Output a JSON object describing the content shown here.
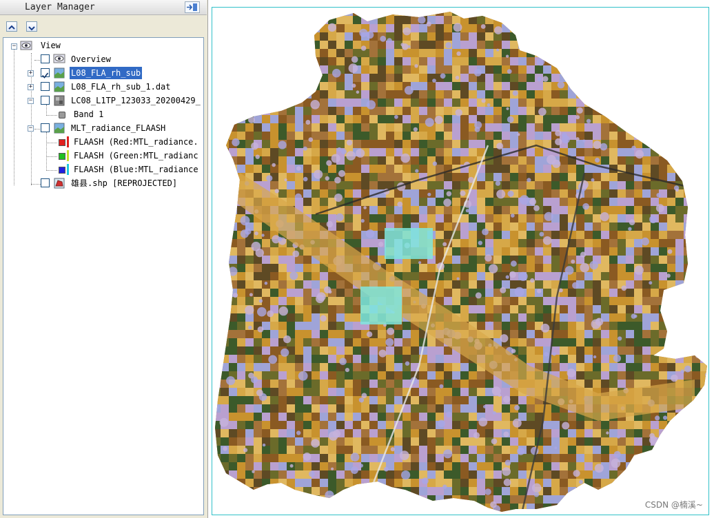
{
  "panel": {
    "title": "Layer Manager",
    "move_up_icon": "arrow-up-icon",
    "move_down_icon": "arrow-down-icon",
    "dock_icon": "dock-icon"
  },
  "tree": {
    "root": {
      "label": "View",
      "expanded": true
    },
    "overview": {
      "label": "Overview",
      "checked": false
    },
    "layers": [
      {
        "label": "L08_FLA_rh_sub",
        "checked": true,
        "selected": true,
        "expanded": false
      },
      {
        "label": "L08_FLA_rh_sub_1.dat",
        "checked": false,
        "expanded": false
      },
      {
        "label": "LC08_L1TP_123033_20200429_",
        "checked": false,
        "expanded": true,
        "children": [
          {
            "label": "Band 1",
            "swatch": "#9a9a9a"
          }
        ]
      },
      {
        "label": "MLT_radiance_FLAASH",
        "checked": false,
        "expanded": true,
        "children": [
          {
            "label": "FLAASH (Red:MTL_radiance.",
            "swatch": "#e02020"
          },
          {
            "label": "FLAASH (Green:MTL_radianc",
            "swatch": "#20c020"
          },
          {
            "label": "FLAASH (Blue:MTL_radiance",
            "swatch": "#2020e0"
          }
        ]
      },
      {
        "label": "雄县.shp [REPROJECTED]",
        "checked": false,
        "expanded": false
      }
    ]
  },
  "map": {
    "frame_color": "#30c0c8",
    "palette": [
      "#c8922e",
      "#8a5a22",
      "#a3723a",
      "#5e4a24",
      "#d6a848",
      "#6b6b2a",
      "#9fa4d8",
      "#b9a0d0",
      "#3c5a2a",
      "#e0b860"
    ]
  },
  "watermark": "CSDN @楠溪~"
}
